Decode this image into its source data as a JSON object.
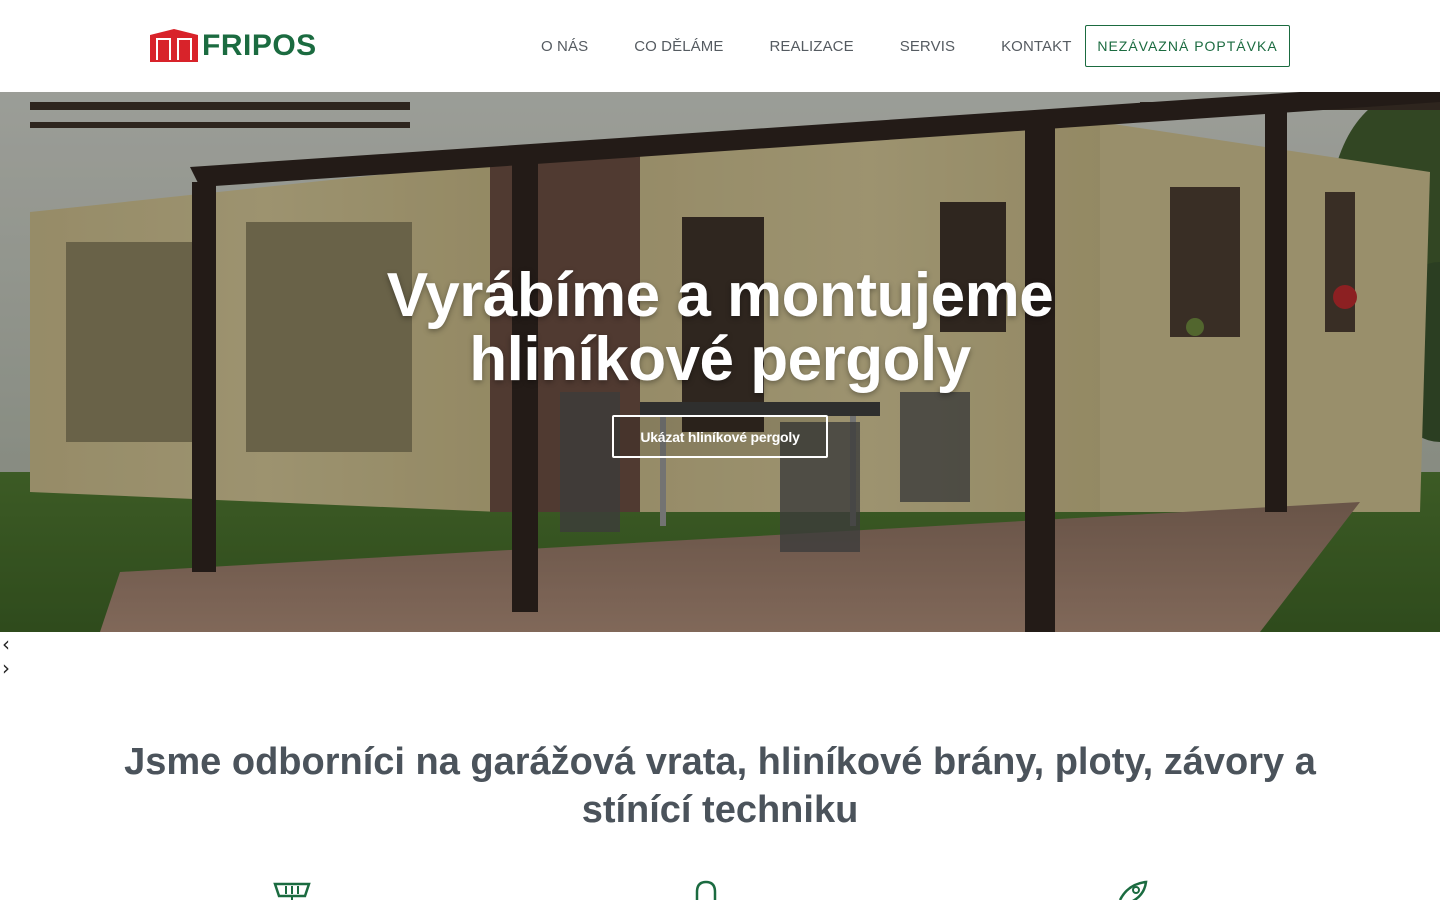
{
  "header": {
    "brand": "FRIPOS",
    "nav": [
      {
        "label": "O NÁS"
      },
      {
        "label": "CO DĚLÁME"
      },
      {
        "label": "REALIZACE"
      },
      {
        "label": "SERVIS"
      },
      {
        "label": "KONTAKT"
      }
    ],
    "cta_label": "NEZÁVAZNÁ POPTÁVKA"
  },
  "hero": {
    "title_line1": "Vyrábíme a montujeme",
    "title_line2": "hliníkové pergoly",
    "button_label": "Ukázat hliníkové pergoly"
  },
  "slider": {
    "prev_icon": "‹",
    "next_icon": "›"
  },
  "intro": {
    "line1": "Jsme odborníci na garážová vrata, hliníkové brány, ploty, závory a",
    "line2": "stínící techniku"
  },
  "features": {
    "icons": [
      "garage-door-icon",
      "bell-icon",
      "rocket-icon"
    ]
  },
  "colors": {
    "brand_green": "#1b6b40",
    "brand_red": "#d8232a",
    "nav_text": "#555b61",
    "intro_text": "#4b535b"
  }
}
